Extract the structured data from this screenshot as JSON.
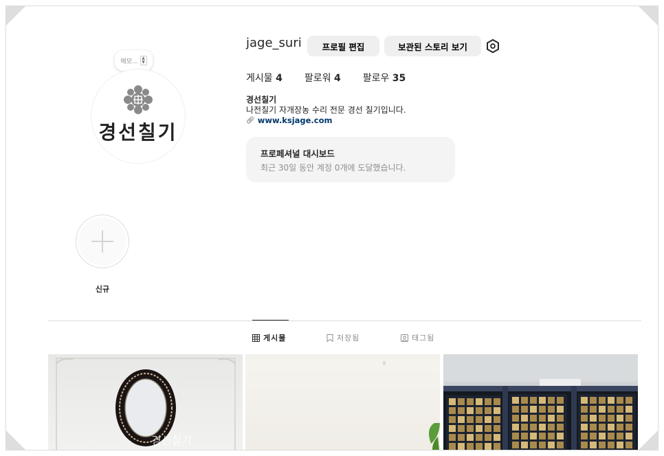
{
  "profile": {
    "username": "jage_suri",
    "edit_button": "프로필 편집",
    "archive_button": "보관된 스토리 보기",
    "avatar_text": "경선칠기",
    "note_placeholder": "메모...",
    "stats": [
      {
        "label": "게시물",
        "value": "4"
      },
      {
        "label": "팔로워",
        "value": "4"
      },
      {
        "label": "팔로우",
        "value": "35"
      }
    ],
    "bio_name": "경선칠기",
    "bio_text": "나전칠기 자개장농 수리 전문 경선 칠기입니다.",
    "bio_link": "www.ksjage.com"
  },
  "dashboard": {
    "title": "프로페셔널 대시보드",
    "subtitle": "최근 30일 동안 계정 0개에 도달했습니다."
  },
  "highlights": {
    "new_label": "신규"
  },
  "tabs": [
    {
      "label": "게시물",
      "icon": "grid-icon",
      "active": true
    },
    {
      "label": "저장됨",
      "icon": "bookmark-icon",
      "active": false
    },
    {
      "label": "태그됨",
      "icon": "tag-icon",
      "active": false
    }
  ],
  "posts": [
    {
      "alt": "mother-of-pearl oval mirror",
      "watermark": "경선칠기"
    },
    {
      "alt": "bright room"
    },
    {
      "alt": "mother-of-pearl cabinet"
    }
  ]
}
